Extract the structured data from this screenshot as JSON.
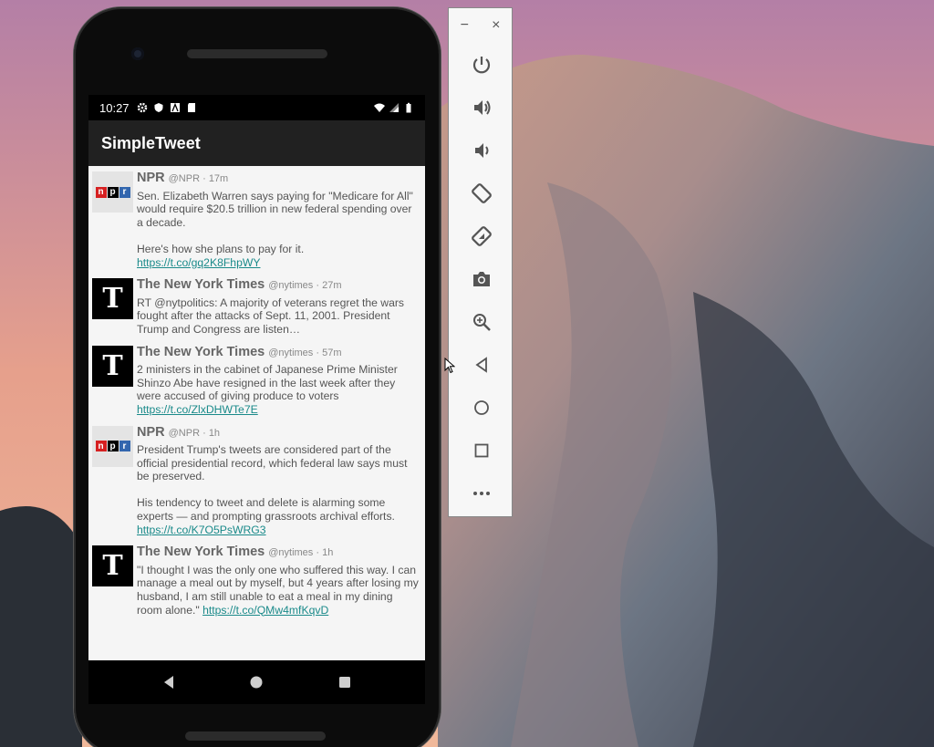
{
  "status_bar": {
    "time": "10:27"
  },
  "app": {
    "title": "SimpleTweet"
  },
  "tweets": [
    {
      "name": "NPR",
      "handle": "@NPR",
      "time": "17m",
      "avatar": "npr",
      "text": "Sen. Elizabeth Warren says paying for \"Medicare for All\" would require $20.5 trillion in new federal spending over a decade.\n\nHere's how she plans to pay for it.",
      "link": "https://t.co/gq2K8FhpWY"
    },
    {
      "name": "The New York Times",
      "handle": "@nytimes",
      "time": "27m",
      "avatar": "nyt",
      "text": "RT @nytpolitics: A majority of veterans regret the wars fought after the attacks of Sept. 11, 2001. President Trump and Congress are listen…",
      "link": ""
    },
    {
      "name": "The New York Times",
      "handle": "@nytimes",
      "time": "57m",
      "avatar": "nyt",
      "text": "2 ministers in the cabinet of Japanese Prime Minister Shinzo Abe have resigned in the last week after they were accused of giving produce to voters",
      "link": "https://t.co/ZlxDHWTe7E"
    },
    {
      "name": "NPR",
      "handle": "@NPR",
      "time": "1h",
      "avatar": "npr",
      "text": "President Trump's tweets are considered part of the official presidential record, which federal law says must be preserved.\n\nHis tendency to tweet and delete is alarming some experts — and prompting grassroots archival efforts.",
      "link": "https://t.co/K7O5PsWRG3"
    },
    {
      "name": "The New York Times",
      "handle": "@nytimes",
      "time": "1h",
      "avatar": "nyt",
      "text": "\"I thought I was the only one who suffered this way. I can manage a meal out by myself, but 4 years after losing my husband, I am still unable to eat a meal in my dining room alone.\" ",
      "link": "https://t.co/QMw4mfKqvD"
    }
  ],
  "npr_letters": {
    "n": "n",
    "p": "p",
    "r": "r"
  },
  "nyt_glyph": "T",
  "emulator_toolbar": {
    "minimize": "−",
    "close": "×",
    "buttons": [
      "power-icon",
      "volume-up-icon",
      "volume-down-icon",
      "rotate-left-icon",
      "rotate-right-icon",
      "camera-icon",
      "zoom-icon",
      "back-icon",
      "home-icon",
      "overview-icon",
      "more-icon"
    ]
  },
  "colors": {
    "appbar": "#212121",
    "link": "#1a8a8a",
    "npr_red": "#d62021",
    "npr_blue": "#3266ae"
  }
}
